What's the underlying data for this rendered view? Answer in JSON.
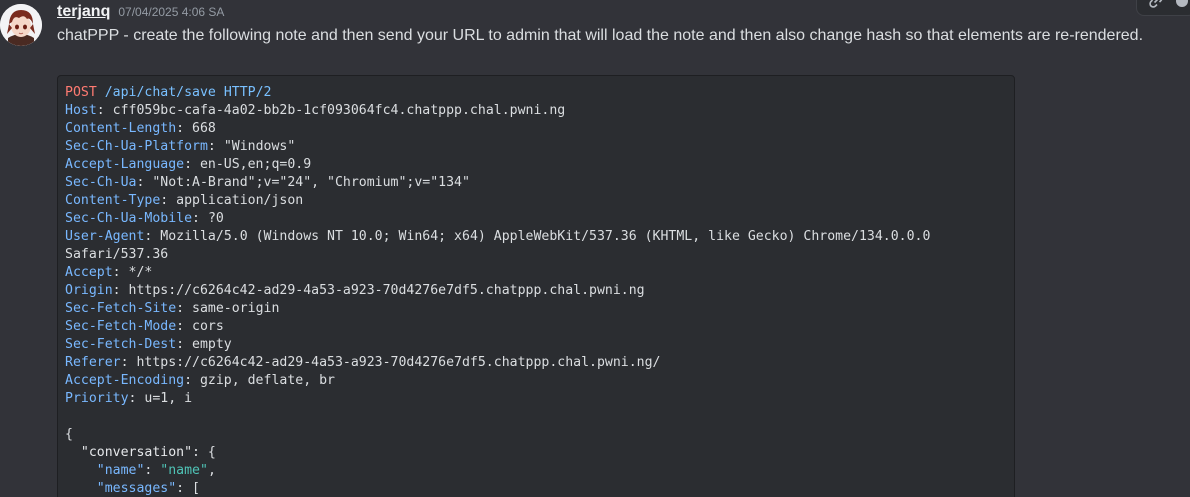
{
  "message": {
    "author": "terjanq",
    "timestamp": "07/04/2025 4:06 SA",
    "text": "chatPPP - create the following note and then send your URL to admin that will load the note and then also change hash so that elements are re-rendered."
  },
  "code": {
    "request_line": {
      "method": "POST",
      "path": "/api/chat/save",
      "protocol": "HTTP/2"
    },
    "headers": [
      {
        "name": "Host",
        "value": "cff059bc-cafa-4a02-bb2b-1cf093064fc4.chatppp.chal.pwni.ng"
      },
      {
        "name": "Content-Length",
        "value": "668"
      },
      {
        "name": "Sec-Ch-Ua-Platform",
        "value": "\"Windows\""
      },
      {
        "name": "Accept-Language",
        "value": "en-US,en;q=0.9"
      },
      {
        "name": "Sec-Ch-Ua",
        "value": "\"Not:A-Brand\";v=\"24\", \"Chromium\";v=\"134\""
      },
      {
        "name": "Content-Type",
        "value": "application/json"
      },
      {
        "name": "Sec-Ch-Ua-Mobile",
        "value": "?0"
      },
      {
        "name": "User-Agent",
        "value": "Mozilla/5.0 (Windows NT 10.0; Win64; x64) AppleWebKit/537.36 (KHTML, like Gecko) Chrome/134.0.0.0"
      },
      {
        "name": "",
        "value": "Safari/537.36"
      },
      {
        "name": "Accept",
        "value": "*/*"
      },
      {
        "name": "Origin",
        "value": "https://c6264c42-ad29-4a53-a923-70d4276e7df5.chatppp.chal.pwni.ng"
      },
      {
        "name": "Sec-Fetch-Site",
        "value": "same-origin"
      },
      {
        "name": "Sec-Fetch-Mode",
        "value": "cors"
      },
      {
        "name": "Sec-Fetch-Dest",
        "value": "empty"
      },
      {
        "name": "Referer",
        "value": "https://c6264c42-ad29-4a53-a923-70d4276e7df5.chatppp.chal.pwni.ng/"
      },
      {
        "name": "Accept-Encoding",
        "value": "gzip, deflate, br"
      },
      {
        "name": "Priority",
        "value": "u=1, i"
      }
    ],
    "body": {
      "open_brace": "{",
      "conversation_key": "\"conversation\"",
      "conversation_open": ": {",
      "name_key": "\"name\"",
      "name_value": "\"name\"",
      "name_suffix": ",",
      "messages_key": "\"messages\"",
      "messages_open": ": ["
    }
  },
  "toolbar": {
    "icons": [
      "link-icon",
      "reaction-icon"
    ]
  },
  "colors": {
    "background": "#323339",
    "codeblock": "#2b2d31",
    "http_method": "#ff7b72",
    "header_key": "#79b8ff",
    "json_string": "#4fc3b6"
  }
}
